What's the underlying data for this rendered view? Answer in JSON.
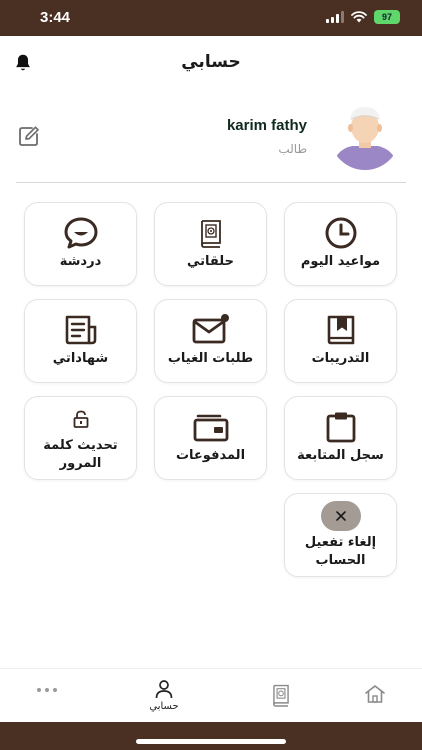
{
  "status_bar": {
    "time": "3:44",
    "battery": "97"
  },
  "header": {
    "title": "حسابي"
  },
  "profile": {
    "name": "karim fathy",
    "role": "طالب"
  },
  "menu": [
    {
      "id": "todays-schedule",
      "label": "مواعيد اليوم",
      "icon": "clock-icon"
    },
    {
      "id": "my-circles",
      "label": "حلقاتي",
      "icon": "quran-book-icon"
    },
    {
      "id": "chat",
      "label": "دردشة",
      "icon": "chat-icon"
    },
    {
      "id": "trainings",
      "label": "التدريبات",
      "icon": "bookmark-book-icon"
    },
    {
      "id": "absence-requests",
      "label": "طلبات الغياب",
      "icon": "mail-badge-icon"
    },
    {
      "id": "certificates",
      "label": "شهاداتي",
      "icon": "certificate-icon"
    },
    {
      "id": "follow-up-log",
      "label": "سجل المتابعة",
      "icon": "clipboard-icon"
    },
    {
      "id": "payments",
      "label": "المدفوعات",
      "icon": "wallet-icon"
    },
    {
      "id": "update-password",
      "label": "تحديث كلمة المرور",
      "icon": "lock-icon"
    },
    {
      "id": "deactivate-account",
      "label": "إلغاء تفعيل الحساب",
      "icon": "close-icon"
    }
  ],
  "bottom_nav": {
    "items": [
      {
        "id": "home",
        "label": "",
        "icon": "home-icon"
      },
      {
        "id": "quran",
        "label": "",
        "icon": "quran-book-icon"
      },
      {
        "id": "account",
        "label": "حسابي",
        "icon": "person-icon",
        "active": true
      },
      {
        "id": "more",
        "label": "",
        "icon": "more-icon"
      }
    ]
  },
  "colors": {
    "brand_dark": "#4a2f23",
    "icon": "#3b2a22",
    "deactivate_circle": "#a59b95",
    "card_border": "#e3e3e3"
  }
}
